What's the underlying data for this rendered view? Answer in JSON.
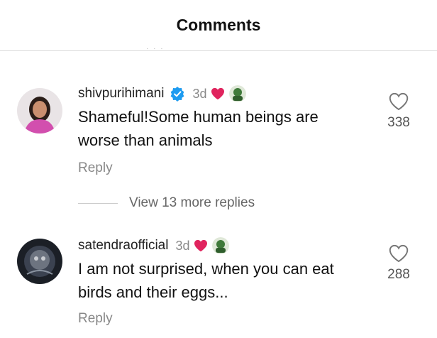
{
  "header": {
    "title": "Comments"
  },
  "comments": [
    {
      "username": "shivpurihimani",
      "verified": true,
      "time": "3d",
      "text_line1": "Shameful!Some human beings are",
      "text_line2": "worse than animals",
      "reply_label": "Reply",
      "like_count": "338"
    },
    {
      "username": "satendraofficial",
      "verified": false,
      "time": "3d",
      "text_line1": "I am not surprised, when you can eat",
      "text_line2": "birds and their eggs...",
      "reply_label": "Reply",
      "like_count": "288"
    }
  ],
  "view_replies": {
    "label": "View 13 more replies"
  },
  "icons": {
    "like": "heart-outline-icon",
    "creator_liked": "red-heart-icon",
    "verified": "verified-badge-icon"
  },
  "colors": {
    "heart_red": "#e0245e",
    "verified_blue": "#1d9bf0"
  }
}
